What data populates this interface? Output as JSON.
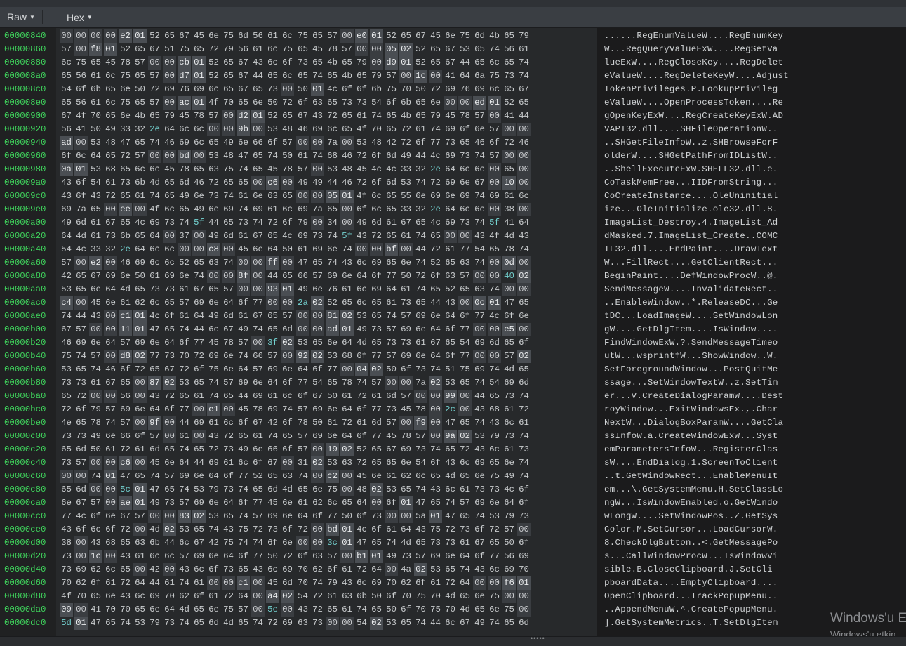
{
  "toolbar": {
    "view_mode": "Raw",
    "encoding": "Hex"
  },
  "rows": [
    {
      "offset": "00000840",
      "hex": "00 00 00 00 e2 01 52 65 67 45 6e 75 6d 56 61 6c 75 65 57 00 e0 01 52 65 67 45 6e 75 6d 4b 65 79",
      "ascii": "......RegEnumValueW....RegEnumKey"
    },
    {
      "offset": "00000860",
      "hex": "57 00 f8 01 52 65 67 51 75 65 72 79 56 61 6c 75 65 45 78 57 00 00 05 02 52 65 67 53 65 74 56 61",
      "ascii": "W...RegQueryValueExW....RegSetVa"
    },
    {
      "offset": "00000880",
      "hex": "6c 75 65 45 78 57 00 00 cb 01 52 65 67 43 6c 6f 73 65 4b 65 79 00 d9 01 52 65 67 44 65 6c 65 74",
      "ascii": "lueExW....RegCloseKey....RegDelet"
    },
    {
      "offset": "000008a0",
      "hex": "65 56 61 6c 75 65 57 00 d7 01 52 65 67 44 65 6c 65 74 65 4b 65 79 57 00 1c 00 41 64 6a 75 73 74",
      "ascii": "eValueW....RegDeleteKeyW....Adjust"
    },
    {
      "offset": "000008c0",
      "hex": "54 6f 6b 65 6e 50 72 69 76 69 6c 65 67 65 73 00 50 01 4c 6f 6f 6b 75 70 50 72 69 76 69 6c 65 67",
      "ascii": "TokenPrivileges.P.LookupPrivileg"
    },
    {
      "offset": "000008e0",
      "hex": "65 56 61 6c 75 65 57 00 ac 01 4f 70 65 6e 50 72 6f 63 65 73 73 54 6f 6b 65 6e 00 00 ed 01 52 65",
      "ascii": "eValueW....OpenProcessToken....Re"
    },
    {
      "offset": "00000900",
      "hex": "67 4f 70 65 6e 4b 65 79 45 78 57 00 d2 01 52 65 67 43 72 65 61 74 65 4b 65 79 45 78 57 00 41 44",
      "ascii": "gOpenKeyExW....RegCreateKeyExW.AD"
    },
    {
      "offset": "00000920",
      "hex": "56 41 50 49 33 32 2e 64 6c 6c 00 00 9b 00 53 48 46 69 6c 65 4f 70 65 72 61 74 69 6f 6e 57 00 00",
      "ascii": "VAPI32.dll....SHFileOperationW.."
    },
    {
      "offset": "00000940",
      "hex": "ad 00 53 48 47 65 74 46 69 6c 65 49 6e 66 6f 57 00 00 7a 00 53 48 42 72 6f 77 73 65 46 6f 72 46",
      "ascii": "..SHGetFileInfoW..z.SHBrowseForF"
    },
    {
      "offset": "00000960",
      "hex": "6f 6c 64 65 72 57 00 00 bd 00 53 48 47 65 74 50 61 74 68 46 72 6f 6d 49 44 4c 69 73 74 57 00 00",
      "ascii": "olderW....SHGetPathFromIDListW.."
    },
    {
      "offset": "00000980",
      "hex": "0a 01 53 68 65 6c 6c 45 78 65 63 75 74 65 45 78 57 00 53 48 45 4c 4c 33 32 2e 64 6c 6c 00 65 00",
      "ascii": "..ShellExecuteExW.SHELL32.dll.e."
    },
    {
      "offset": "000009a0",
      "hex": "43 6f 54 61 73 6b 4d 65 6d 46 72 65 65 00 c6 00 49 49 44 46 72 6f 6d 53 74 72 69 6e 67 00 10 00",
      "ascii": "CoTaskMemFree...IIDFromString..."
    },
    {
      "offset": "000009c0",
      "hex": "43 6f 43 72 65 61 74 65 49 6e 73 74 61 6e 63 65 00 00 05 01 4f 6c 65 55 6e 69 6e 69 74 69 61 6c",
      "ascii": "CoCreateInstance....OleUninitial"
    },
    {
      "offset": "000009e0",
      "hex": "69 7a 65 00 ee 00 4f 6c 65 49 6e 69 74 69 61 6c 69 7a 65 00 6f 6c 65 33 32 2e 64 6c 6c 00 38 00",
      "ascii": "ize...OleInitialize.ole32.dll.8."
    },
    {
      "offset": "00000a00",
      "hex": "49 6d 61 67 65 4c 69 73 74 5f 44 65 73 74 72 6f 79 00 34 00 49 6d 61 67 65 4c 69 73 74 5f 41 64",
      "ascii": "ImageList_Destroy.4.ImageList_Ad"
    },
    {
      "offset": "00000a20",
      "hex": "64 4d 61 73 6b 65 64 00 37 00 49 6d 61 67 65 4c 69 73 74 5f 43 72 65 61 74 65 00 00 43 4f 4d 43",
      "ascii": "dMasked.7.ImageList_Create..COMC"
    },
    {
      "offset": "00000a40",
      "hex": "54 4c 33 32 2e 64 6c 6c 00 00 c8 00 45 6e 64 50 61 69 6e 74 00 00 bf 00 44 72 61 77 54 65 78 74",
      "ascii": "TL32.dll....EndPaint....DrawText"
    },
    {
      "offset": "00000a60",
      "hex": "57 00 e2 00 46 69 6c 6c 52 65 63 74 00 00 ff 00 47 65 74 43 6c 69 65 6e 74 52 65 63 74 00 0d 00",
      "ascii": "W...FillRect....GetClientRect..."
    },
    {
      "offset": "00000a80",
      "hex": "42 65 67 69 6e 50 61 69 6e 74 00 00 8f 00 44 65 66 57 69 6e 64 6f 77 50 72 6f 63 57 00 00 40 02",
      "ascii": "BeginPaint....DefWindowProcW..@."
    },
    {
      "offset": "00000aa0",
      "hex": "53 65 6e 64 4d 65 73 73 61 67 65 57 00 00 93 01 49 6e 76 61 6c 69 64 61 74 65 52 65 63 74 00 00",
      "ascii": "SendMessageW....InvalidateRect.."
    },
    {
      "offset": "00000ac0",
      "hex": "c4 00 45 6e 61 62 6c 65 57 69 6e 64 6f 77 00 00 2a 02 52 65 6c 65 61 73 65 44 43 00 0c 01 47 65",
      "ascii": "..EnableWindow..*.ReleaseDC...Ge"
    },
    {
      "offset": "00000ae0",
      "hex": "74 44 43 00 c1 01 4c 6f 61 64 49 6d 61 67 65 57 00 00 81 02 53 65 74 57 69 6e 64 6f 77 4c 6f 6e",
      "ascii": "tDC...LoadImageW....SetWindowLon"
    },
    {
      "offset": "00000b00",
      "hex": "67 57 00 00 11 01 47 65 74 44 6c 67 49 74 65 6d 00 00 ad 01 49 73 57 69 6e 64 6f 77 00 00 e5 00",
      "ascii": "gW....GetDlgItem....IsWindow...."
    },
    {
      "offset": "00000b20",
      "hex": "46 69 6e 64 57 69 6e 64 6f 77 45 78 57 00 3f 02 53 65 6e 64 4d 65 73 73 61 67 65 54 69 6d 65 6f",
      "ascii": "FindWindowExW.?.SendMessageTimeo"
    },
    {
      "offset": "00000b40",
      "hex": "75 74 57 00 d8 02 77 73 70 72 69 6e 74 66 57 00 92 02 53 68 6f 77 57 69 6e 64 6f 77 00 00 57 02",
      "ascii": "utW...wsprintfW...ShowWindow..W."
    },
    {
      "offset": "00000b60",
      "hex": "53 65 74 46 6f 72 65 67 72 6f 75 6e 64 57 69 6e 64 6f 77 00 04 02 50 6f 73 74 51 75 69 74 4d 65",
      "ascii": "SetForegroundWindow...PostQuitMe"
    },
    {
      "offset": "00000b80",
      "hex": "73 73 61 67 65 00 87 02 53 65 74 57 69 6e 64 6f 77 54 65 78 74 57 00 00 7a 02 53 65 74 54 69 6d",
      "ascii": "ssage...SetWindowTextW..z.SetTim"
    },
    {
      "offset": "00000ba0",
      "hex": "65 72 00 00 56 00 43 72 65 61 74 65 44 69 61 6c 6f 67 50 61 72 61 6d 57 00 00 99 00 44 65 73 74",
      "ascii": "er...V.CreateDialogParamW....Dest"
    },
    {
      "offset": "00000bc0",
      "hex": "72 6f 79 57 69 6e 64 6f 77 00 e1 00 45 78 69 74 57 69 6e 64 6f 77 73 45 78 00 2c 00 43 68 61 72",
      "ascii": "royWindow...ExitWindowsEx.,.Char"
    },
    {
      "offset": "00000be0",
      "hex": "4e 65 78 74 57 00 9f 00 44 69 61 6c 6f 67 42 6f 78 50 61 72 61 6d 57 00 f9 00 47 65 74 43 6c 61",
      "ascii": "NextW...DialogBoxParamW....GetCla"
    },
    {
      "offset": "00000c00",
      "hex": "73 73 49 6e 66 6f 57 00 61 00 43 72 65 61 74 65 57 69 6e 64 6f 77 45 78 57 00 9a 02 53 79 73 74",
      "ascii": "ssInfoW.a.CreateWindowExW...Syst"
    },
    {
      "offset": "00000c20",
      "hex": "65 6d 50 61 72 61 6d 65 74 65 72 73 49 6e 66 6f 57 00 19 02 52 65 67 69 73 74 65 72 43 6c 61 73",
      "ascii": "emParametersInfoW...RegisterClas"
    },
    {
      "offset": "00000c40",
      "hex": "73 57 00 00 c6 00 45 6e 64 44 69 61 6c 6f 67 00 31 02 53 63 72 65 65 6e 54 6f 43 6c 69 65 6e 74",
      "ascii": "sW....EndDialog.1.ScreenToClient"
    },
    {
      "offset": "00000c60",
      "hex": "00 00 74 01 47 65 74 57 69 6e 64 6f 77 52 65 63 74 00 c2 00 45 6e 61 62 6c 65 4d 65 6e 75 49 74",
      "ascii": "..t.GetWindowRect...EnableMenuIt"
    },
    {
      "offset": "00000c80",
      "hex": "65 6d 00 00 5c 01 47 65 74 53 79 73 74 65 6d 4d 65 6e 75 00 48 02 53 65 74 43 6c 61 73 73 4c 6f",
      "ascii": "em...\\.GetSystemMenu.H.SetClassLo"
    },
    {
      "offset": "00000ca0",
      "hex": "6e 67 57 00 ae 01 49 73 57 69 6e 64 6f 77 45 6e 61 62 6c 65 64 00 6f 01 47 65 74 57 69 6e 64 6f",
      "ascii": "ngW...IsWindowEnabled.o.GetWindo"
    },
    {
      "offset": "00000cc0",
      "hex": "77 4c 6f 6e 67 57 00 00 83 02 53 65 74 57 69 6e 64 6f 77 50 6f 73 00 00 5a 01 47 65 74 53 79 73",
      "ascii": "wLongW....SetWindowPos..Z.GetSys"
    },
    {
      "offset": "00000ce0",
      "hex": "43 6f 6c 6f 72 00 4d 02 53 65 74 43 75 72 73 6f 72 00 bd 01 4c 6f 61 64 43 75 72 73 6f 72 57 00",
      "ascii": "Color.M.SetCursor...LoadCursorW."
    },
    {
      "offset": "00000d00",
      "hex": "38 00 43 68 65 63 6b 44 6c 67 42 75 74 74 6f 6e 00 00 3c 01 47 65 74 4d 65 73 73 61 67 65 50 6f",
      "ascii": "8.CheckDlgButton..<.GetMessagePo"
    },
    {
      "offset": "00000d20",
      "hex": "73 00 1c 00 43 61 6c 6c 57 69 6e 64 6f 77 50 72 6f 63 57 00 b1 01 49 73 57 69 6e 64 6f 77 56 69",
      "ascii": "s...CallWindowProcW...IsWindowVi"
    },
    {
      "offset": "00000d40",
      "hex": "73 69 62 6c 65 00 42 00 43 6c 6f 73 65 43 6c 69 70 62 6f 61 72 64 00 4a 02 53 65 74 43 6c 69 70",
      "ascii": "sible.B.CloseClipboard.J.SetCli"
    },
    {
      "offset": "00000d60",
      "hex": "70 62 6f 61 72 64 44 61 74 61 00 00 c1 00 45 6d 70 74 79 43 6c 69 70 62 6f 61 72 64 00 00 f6 01",
      "ascii": "pboardData....EmptyClipboard...."
    },
    {
      "offset": "00000d80",
      "hex": "4f 70 65 6e 43 6c 69 70 62 6f 61 72 64 00 a4 02 54 72 61 63 6b 50 6f 70 75 70 4d 65 6e 75 00 00",
      "ascii": "OpenClipboard...TrackPopupMenu.."
    },
    {
      "offset": "00000da0",
      "hex": "09 00 41 70 70 65 6e 64 4d 65 6e 75 57 00 5e 00 43 72 65 61 74 65 50 6f 70 75 70 4d 65 6e 75 00",
      "ascii": "..AppendMenuW.^.CreatePopupMenu."
    },
    {
      "offset": "00000dc0",
      "hex": "5d 01 47 65 74 53 79 73 74 65 6d 4d 65 74 72 69 63 73 00 00 54 02 53 65 74 44 6c 67 49 74 65 6d",
      "ascii": "].GetSystemMetrics..T.SetDlgItem"
    }
  ],
  "watermark": {
    "line1": "Windows'u E",
    "line2": "Windows'u etkin"
  },
  "colors": {
    "offset": "#3fd35c",
    "byte_text": "#c8cbcd",
    "zero_cell": "#3a3d41",
    "highlight_cell": "#4a4e53",
    "punct_byte": "#73d1cf"
  }
}
